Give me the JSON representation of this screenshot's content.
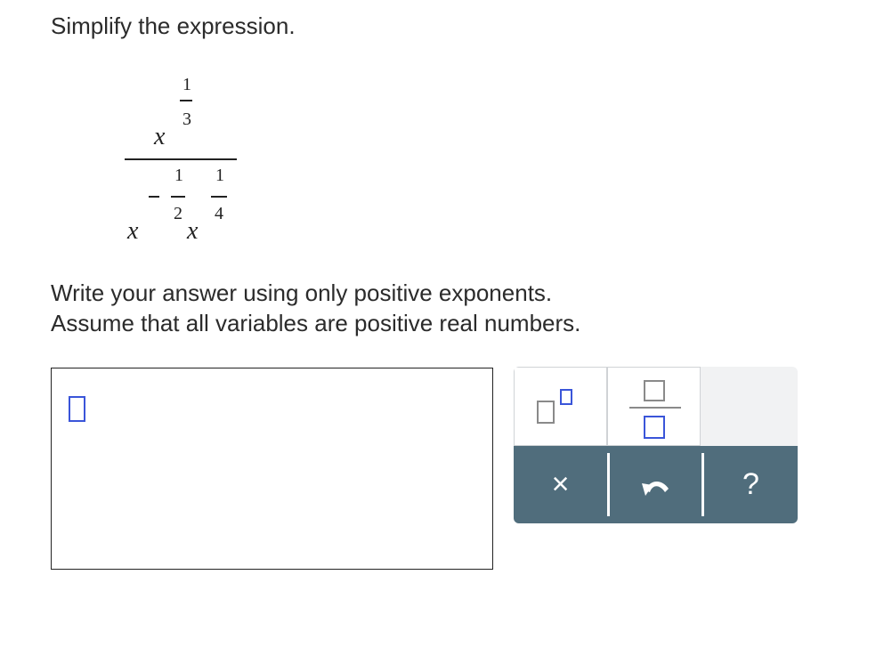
{
  "prompt": {
    "title": "Simplify the expression.",
    "instructions_line1": "Write your answer using only positive exponents.",
    "instructions_line2": "Assume that all variables are positive real numbers."
  },
  "expression": {
    "numerator_base": "x",
    "numerator_exp_num": "1",
    "numerator_exp_den": "3",
    "denominator_base1": "x",
    "denominator_exp1_sign": "−",
    "denominator_exp1_num": "1",
    "denominator_exp1_den": "2",
    "denominator_base2": "x",
    "denominator_exp2_num": "1",
    "denominator_exp2_den": "4"
  },
  "toolbar": {
    "clear_symbol": "×",
    "undo_symbol": "↶",
    "help_symbol": "?"
  },
  "colors": {
    "accent_blue": "#3a55d9",
    "toolbar_bg": "#506d7c",
    "palette_bg": "#f1f2f3"
  },
  "icons": {
    "superscript": "superscript-template-icon",
    "fraction": "fraction-template-icon",
    "clear": "clear-icon",
    "undo": "undo-icon",
    "help": "help-icon"
  }
}
